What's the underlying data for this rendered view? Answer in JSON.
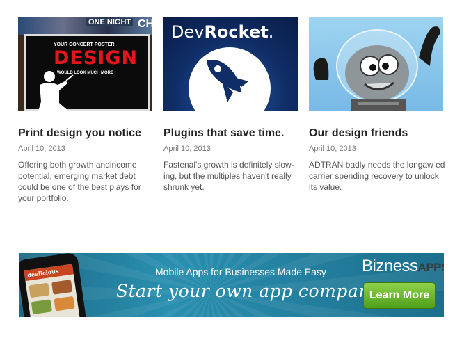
{
  "cards": [
    {
      "title": "Print design you notice",
      "date": "April 10, 2013",
      "excerpt": "Offering both growth andincome  potential, emerging market debt could be one of the best plays for your portfolio.",
      "image": {
        "top_words": [
          "ONE NIGHT",
          "CH"
        ],
        "poster_top": "YOUR CONCERT POSTER",
        "poster_big": "DESIGN",
        "poster_bottom": "WOULD LOOK MUCH MORE"
      }
    },
    {
      "title": "Plugins that save time.",
      "date": "April 10, 2013",
      "excerpt": "Fastenal's growth is definitely slow- ing, but the multiples haven't really shrunk yet.",
      "image": {
        "logo_light": "Dev",
        "logo_bold": "Rocket",
        "logo_mark": "."
      }
    },
    {
      "title": "Our design friends",
      "date": "April 10, 2013",
      "excerpt": "ADTRAN badly needs the longaw ed carrier spending recovery to unlock its value.",
      "image": {}
    }
  ],
  "banner": {
    "subtitle": "Mobile Apps for Businesses Made Easy",
    "headline": "Start your own app company",
    "brand_main": "Bizness",
    "brand_suffix": "APPS",
    "cta_label": "Learn More",
    "phone_app_name": "deelicious",
    "colors": {
      "cta": "#5aab22",
      "banner_bg": "#2a8fb0"
    }
  }
}
